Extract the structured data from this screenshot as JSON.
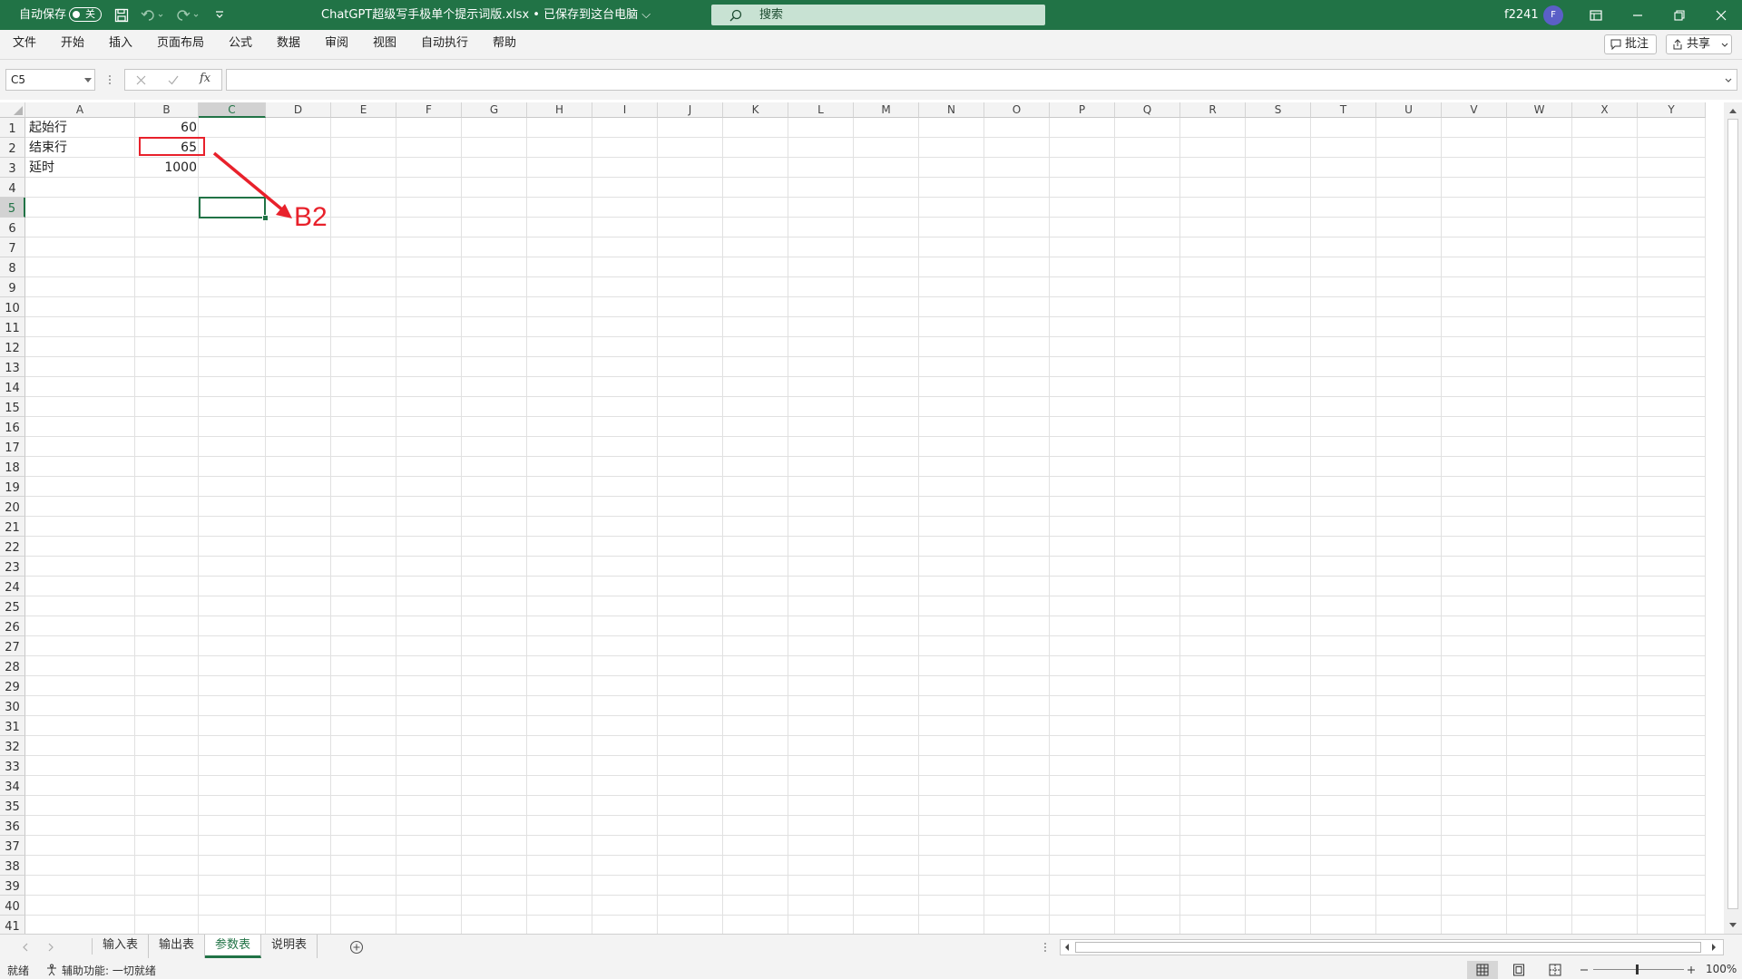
{
  "titlebar": {
    "autosave_label": "自动保存",
    "autosave_state": "关",
    "file_title": "ChatGPT超级写手极单个提示词版.xlsx • 已保存到这台电脑 ⌵",
    "search_placeholder": "搜索",
    "user_name": "f2241",
    "avatar_initial": "F",
    "accent": "#217346"
  },
  "ribbon": {
    "tabs": [
      "文件",
      "开始",
      "插入",
      "页面布局",
      "公式",
      "数据",
      "审阅",
      "视图",
      "自动执行",
      "帮助"
    ],
    "comment_button": "批注",
    "share_button": "共享"
  },
  "formula_bar": {
    "name_box": "C5",
    "fx_label": "fx",
    "formula": ""
  },
  "grid": {
    "columns": [
      "A",
      "B",
      "C",
      "D",
      "E",
      "F",
      "G",
      "H",
      "I",
      "J",
      "K",
      "L",
      "M",
      "N",
      "O",
      "P",
      "Q",
      "R",
      "S",
      "T",
      "U",
      "V",
      "W",
      "X",
      "Y"
    ],
    "rows": [
      "1",
      "2",
      "3",
      "4",
      "5",
      "6",
      "7",
      "8",
      "9",
      "10",
      "11",
      "12",
      "13",
      "14",
      "15",
      "16",
      "17",
      "18",
      "19",
      "20",
      "21",
      "22",
      "23",
      "24",
      "25",
      "26",
      "27",
      "28",
      "29",
      "30",
      "31",
      "32",
      "33",
      "34",
      "35",
      "36",
      "37",
      "38",
      "39",
      "40",
      "41"
    ],
    "selected_column": "C",
    "selected_row": "5",
    "cells": {
      "A1": "起始行",
      "B1": "60",
      "A2": "结束行",
      "B2": "65",
      "A3": "延时",
      "B3": "1000"
    },
    "annotation_label": "B2",
    "annotation_color": "#e8212b"
  },
  "sheet_tabs": {
    "tabs": [
      "输入表",
      "输出表",
      "参数表",
      "说明表"
    ],
    "active": "参数表"
  },
  "status_bar": {
    "ready": "就绪",
    "accessibility": "辅助功能: 一切就绪",
    "zoom": "100%"
  }
}
